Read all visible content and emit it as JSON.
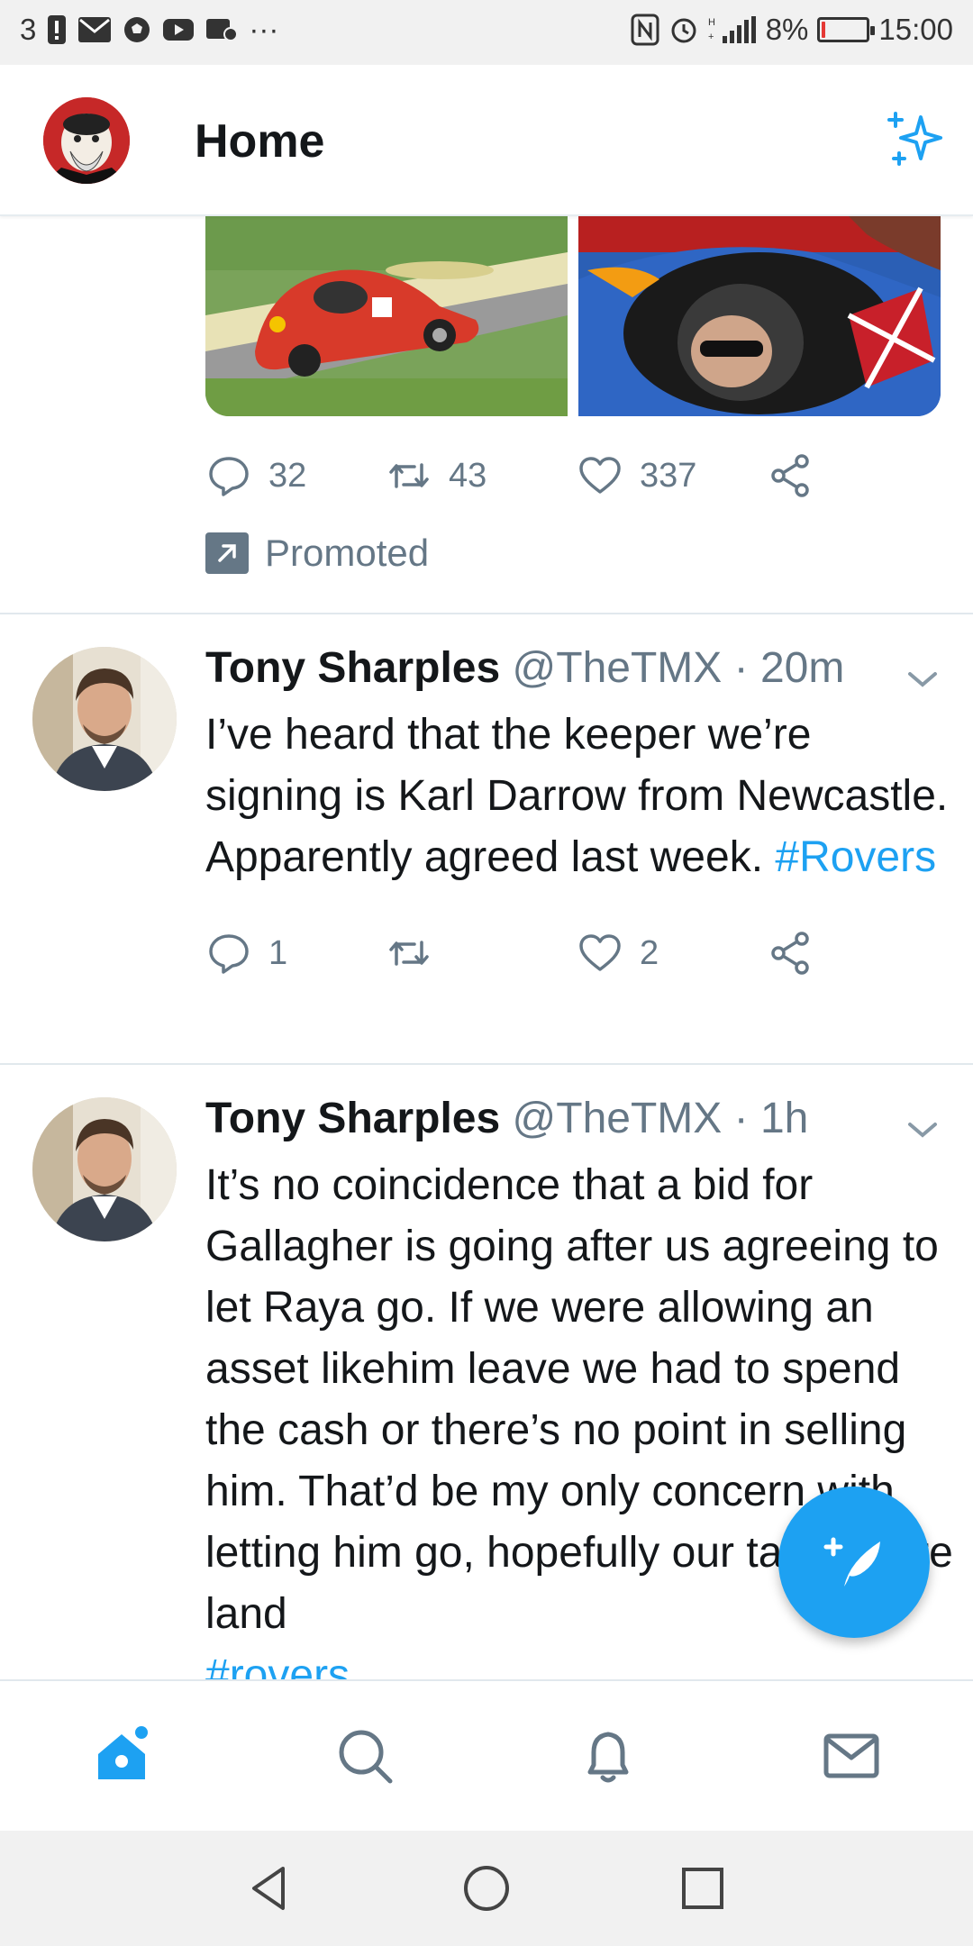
{
  "status_bar": {
    "left_text": "3",
    "left_icons": [
      "notification-badge-icon",
      "mail-icon",
      "football-icon",
      "youtube-icon",
      "photos-icon",
      "more-dots-icon"
    ],
    "more": "···",
    "right_icons": [
      "nfc-icon",
      "alarm-icon",
      "signal-icon"
    ],
    "battery": "8%",
    "battery_level": 0.08,
    "time": "15:00"
  },
  "app_bar": {
    "title": "Home",
    "avatar_icon": "profile-avatar",
    "sparkle_icon": "sparkle-icon"
  },
  "promoted_tweet": {
    "stats": {
      "replies": "32",
      "retweets": "43",
      "likes": "337"
    },
    "promoted_label": "Promoted"
  },
  "tweets": [
    {
      "name": "Tony Sharples",
      "handle": "@TheTMX",
      "time": "· 20m",
      "text": "I’ve heard that the keeper we’re signing is Karl Darrow from Newcastle. Apparently agreed last week. ",
      "hashtag": "#Rovers",
      "stats": {
        "replies": "1",
        "retweets": "",
        "likes": "2"
      }
    },
    {
      "name": "Tony Sharples",
      "handle": "@TheTMX",
      "time": "· 1h",
      "text": "It’s no coincidence that a bid for Gallagher is going after us agreeing to let Raya go. If we were allowing an asset likehim leave we had to spend the cash or there’s no point in selling him. That’d be my only concern with letting him go, hopefully our targets are land",
      "hashtag": "#rovers"
    }
  ],
  "bottom_nav": [
    "home-icon",
    "search-icon",
    "notifications-icon",
    "messages-icon"
  ],
  "colors": {
    "accent": "#1da1f2",
    "muted": "#657786",
    "text": "#14171a"
  }
}
